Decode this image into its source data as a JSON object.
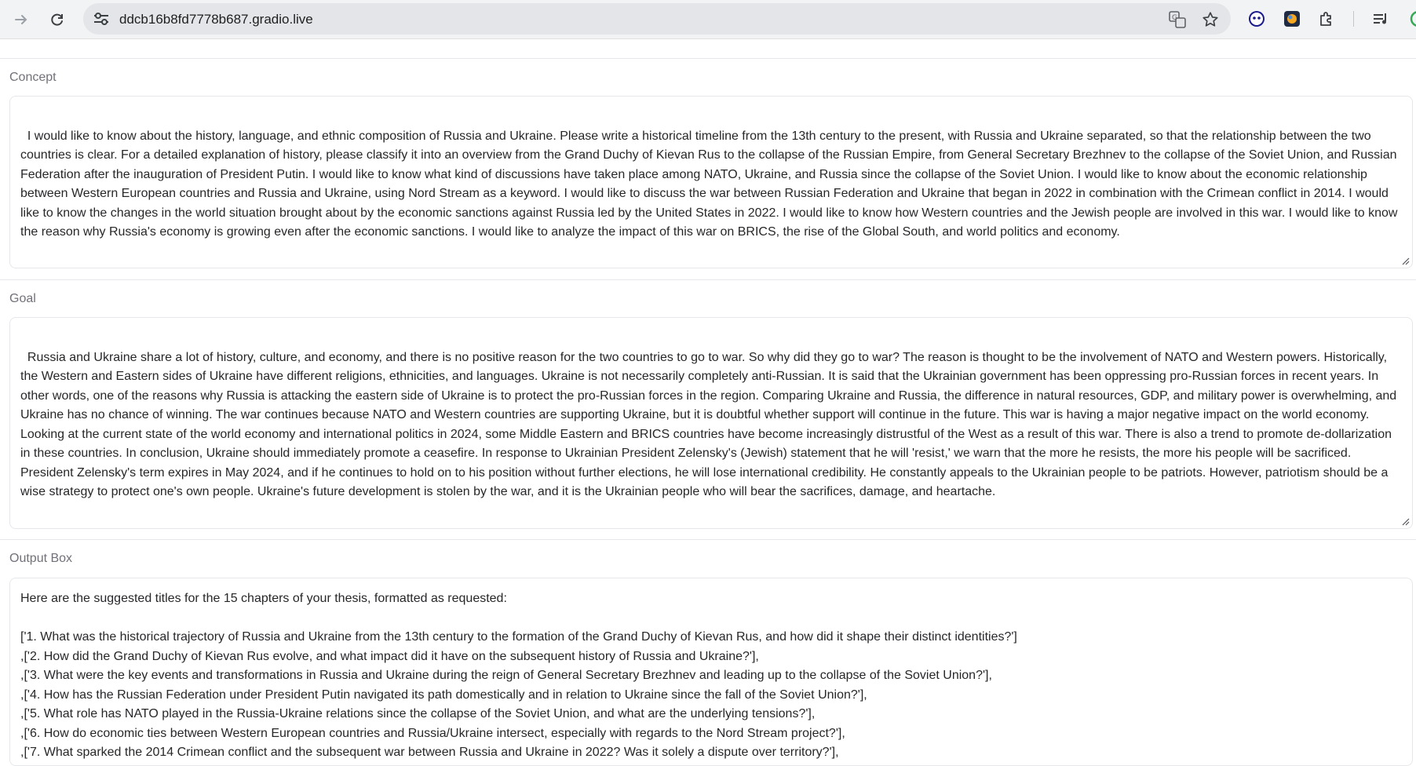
{
  "browser": {
    "url": "ddcb16b8fd7778b687.gradio.live"
  },
  "concept": {
    "label": "Concept",
    "value": "I would like to know about the history, language, and ethnic composition of Russia and Ukraine. Please write a historical timeline from the 13th century to the present, with Russia and Ukraine separated, so that the relationship between the two countries is clear. For a detailed explanation of history, please classify it into an overview from the Grand Duchy of Kievan Rus to the collapse of the Russian Empire, from General Secretary Brezhnev to the collapse of the Soviet Union, and Russian Federation after the inauguration of President Putin. I would like to know what kind of discussions have taken place among NATO, Ukraine, and Russia since the collapse of the Soviet Union. I would like to know about the economic relationship between Western European countries and Russia and Ukraine, using Nord Stream as a keyword. I would like to discuss the war between Russian Federation and Ukraine that began in 2022 in combination with the Crimean conflict in 2014. I would like to know the changes in the world situation brought about by the economic sanctions against Russia led by the United States in 2022. I would like to know how Western countries and the Jewish people are involved in this war. I would like to know the reason why Russia's economy is growing even after the economic sanctions. I would like to analyze the impact of this war on BRICS, the rise of the Global South, and world politics and economy."
  },
  "goal": {
    "label": "Goal",
    "value": "Russia and Ukraine share a lot of history, culture, and economy, and there is no positive reason for the two countries to go to war. So why did they go to war? The reason is thought to be the involvement of NATO and Western powers. Historically, the Western and Eastern sides of Ukraine have different religions, ethnicities, and languages. Ukraine is not necessarily completely anti-Russian. It is said that the Ukrainian government has been oppressing pro-Russian forces in recent years. In other words, one of the reasons why Russia is attacking the eastern side of Ukraine is to protect the pro-Russian forces in the region. Comparing Ukraine and Russia, the difference in natural resources, GDP, and military power is overwhelming, and Ukraine has no chance of winning. The war continues because NATO and Western countries are supporting Ukraine, but it is doubtful whether support will continue in the future. This war is having a major negative impact on the world economy. Looking at the current state of the world economy and international politics in 2024, some Middle Eastern and BRICS countries have become increasingly distrustful of the West as a result of this war. There is also a trend to promote de-dollarization in these countries. In conclusion, Ukraine should immediately promote a ceasefire. In response to Ukrainian President Zelensky's (Jewish) statement that he will 'resist,' we warn that the more he resists, the more his people will be sacrificed. President Zelensky's term expires in May 2024, and if he continues to hold on to his position without further elections, he will lose international credibility. He constantly appeals to the Ukrainian people to be patriots. However, patriotism should be a wise strategy to protect one's own people. Ukraine's future development is stolen by the war, and it is the Ukrainian people who will bear the sacrifices, damage, and heartache."
  },
  "output": {
    "label": "Output Box",
    "lines": [
      "Here are the suggested titles for the 15 chapters of your thesis, formatted as requested:",
      "",
      "['1. What was the historical trajectory of Russia and Ukraine from the 13th century to the formation of the Grand Duchy of Kievan Rus, and how did it shape their distinct identities?']",
      ",['2. How did the Grand Duchy of Kievan Rus evolve, and what impact did it have on the subsequent history of Russia and Ukraine?'],",
      ",['3. What were the key events and transformations in Russia and Ukraine during the reign of General Secretary Brezhnev and leading up to the collapse of the Soviet Union?'],",
      ",['4. How has the Russian Federation under President Putin navigated its path domestically and in relation to Ukraine since the fall of the Soviet Union?'],",
      ",['5. What role has NATO played in the Russia-Ukraine relations since the collapse of the Soviet Union, and what are the underlying tensions?'],",
      ",['6. How do economic ties between Western European countries and Russia/Ukraine intersect, especially with regards to the Nord Stream project?'],",
      ",['7. What sparked the 2014 Crimean conflict and the subsequent war between Russia and Ukraine in 2022? Was it solely a dispute over territory?'],"
    ]
  },
  "icons": {
    "forward": "forward-arrow-icon",
    "reload": "reload-icon",
    "site_settings": "tune-icon",
    "translate": "translate-icon",
    "bookmark": "star-icon",
    "extensions": "puzzle-icon",
    "media": "media-control-icon"
  }
}
